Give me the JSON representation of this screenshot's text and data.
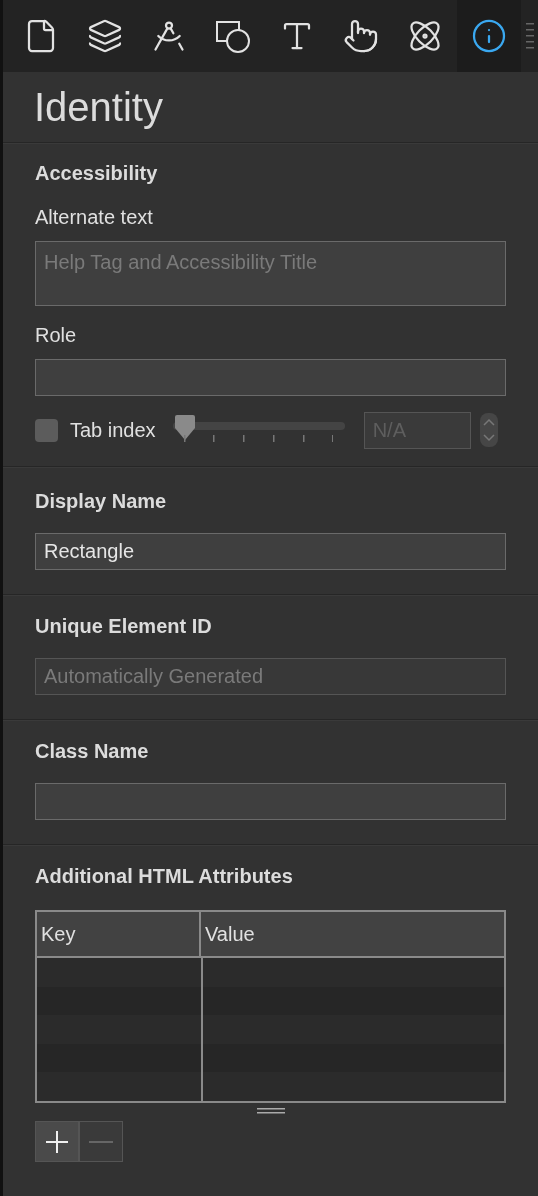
{
  "toolbar": {
    "tabs": [
      {
        "kind": "page",
        "selected": false
      },
      {
        "kind": "layers",
        "selected": false
      },
      {
        "kind": "compass",
        "selected": false
      },
      {
        "kind": "shapes",
        "selected": false
      },
      {
        "kind": "text",
        "selected": false
      },
      {
        "kind": "hand",
        "selected": false
      },
      {
        "kind": "atom",
        "selected": false
      },
      {
        "kind": "info",
        "selected": true
      }
    ]
  },
  "title": "Identity",
  "accessibility": {
    "heading": "Accessibility",
    "alt_label": "Alternate text",
    "alt_placeholder": "Help Tag and Accessibility Title",
    "role_label": "Role",
    "tab_index": {
      "label": "Tab index",
      "checked": false,
      "level": 0,
      "placeholder": "N/A"
    }
  },
  "display_name": {
    "heading": "Display Name",
    "value": "Rectangle"
  },
  "unique_id": {
    "heading": "Unique Element ID",
    "placeholder": "Automatically Generated"
  },
  "class_name": {
    "heading": "Class Name"
  },
  "attributes": {
    "heading": "Additional HTML Attributes",
    "columns": [
      "Key",
      "Value"
    ],
    "buttons": [
      {
        "kind": "add",
        "disabled": false
      },
      {
        "kind": "remove",
        "disabled": true
      }
    ]
  }
}
